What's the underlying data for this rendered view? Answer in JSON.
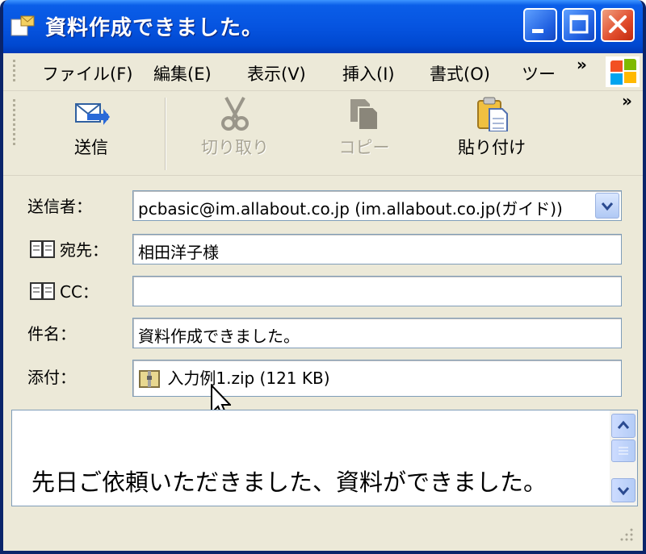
{
  "window": {
    "title": "資料作成できました。",
    "colors": {
      "titlebar": "#0a5ee8",
      "close": "#e04a2a",
      "face": "#ece9d8"
    }
  },
  "menu": {
    "items": [
      "ファイル(F)",
      "編集(E)",
      "表示(V)",
      "挿入(I)",
      "書式(O)",
      "ツー"
    ],
    "overflow": "»"
  },
  "toolbar": {
    "overflow": "»",
    "send": "送信",
    "cut": "切り取り",
    "copy": "コピー",
    "paste": "貼り付け"
  },
  "fields": {
    "from_label": "送信者：",
    "from_value": "pcbasic@im.allabout.co.jp      (im.allabout.co.jp(ガイド))",
    "to_label": "宛先：",
    "to_value": "相田洋子様",
    "cc_label": "CC：",
    "cc_value": "",
    "subject_label": "件名：",
    "subject_value": "資料作成できました。",
    "attach_label": "添付：",
    "attach_value": "入力例1.zip (121 KB)"
  },
  "body": {
    "text": "先日ご依頼いただきました、資料ができました。"
  },
  "icons": [
    "window-icon",
    "send-icon",
    "cut-icon",
    "copy-icon",
    "paste-icon",
    "address-book-icon",
    "zip-file-icon",
    "windows-logo-icon",
    "chevron-down-icon",
    "scroll-up-icon",
    "scroll-down-icon"
  ]
}
